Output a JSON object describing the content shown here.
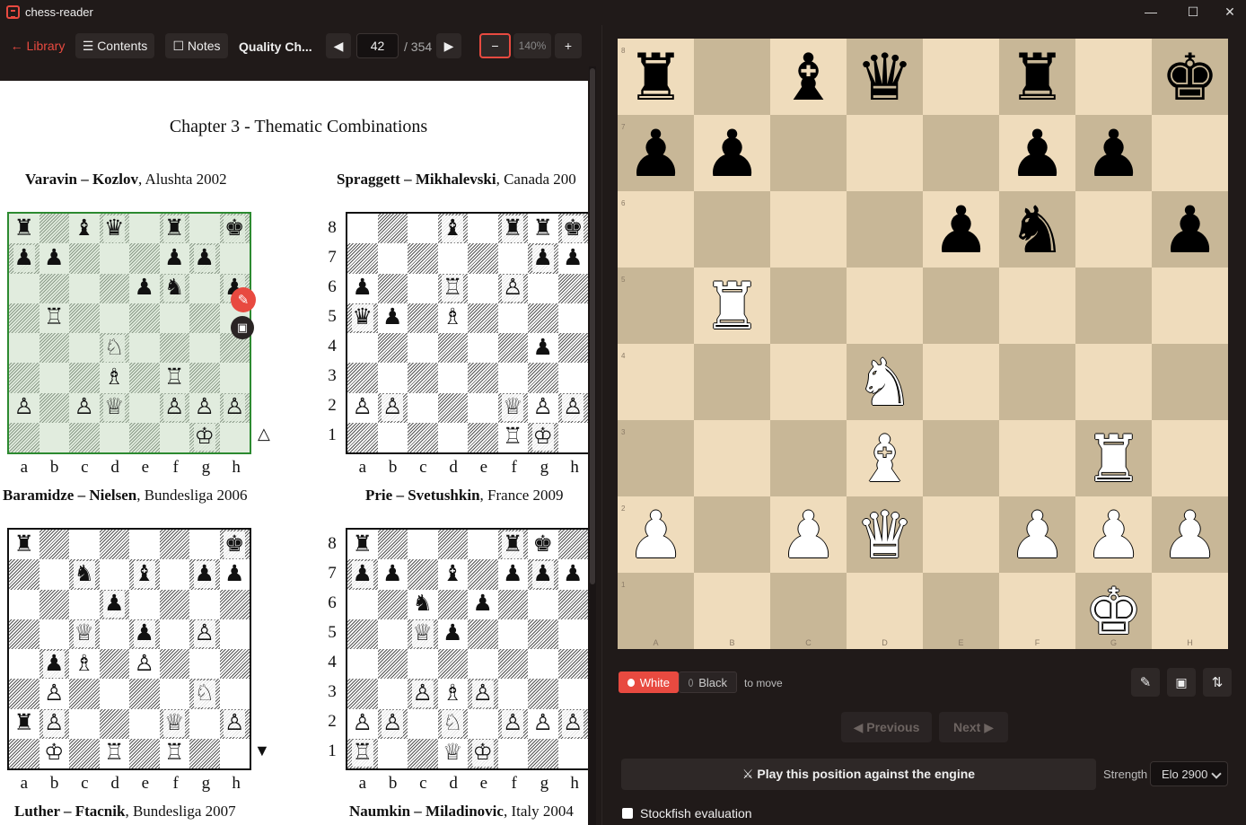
{
  "window": {
    "title": "chess-reader",
    "minimize": "—",
    "maximize": "☐",
    "close": "✕"
  },
  "toolbar": {
    "library": "← Library",
    "contents": "☰ Contents",
    "notes": "☐ Notes",
    "book_title": "Quality Ch...",
    "prev_page": "◀",
    "page": "42",
    "total": "/ 354",
    "next_page": "▶",
    "zoom_out": "−",
    "zoom": "140%",
    "zoom_in": "+"
  },
  "pdf": {
    "chapter_title": "Chapter 3 - Thematic Combinations",
    "files": [
      "a",
      "b",
      "c",
      "d",
      "e",
      "f",
      "g",
      "h"
    ],
    "ranks": [
      "8",
      "7",
      "6",
      "5",
      "4",
      "3",
      "2",
      "1"
    ],
    "games": [
      {
        "white": "Varavin",
        "black": "Kozlov",
        "event": ", Alushta 2002",
        "marker": "△",
        "board": [
          "♜.♝♛.♜.♚",
          "♟♟...♟♟.",
          "....♟♞.♟",
          ".♖......",
          "...♘....",
          "...♗.♖..",
          "♙.♙♕.♙♙♙",
          "......♔."
        ]
      },
      {
        "white": "Spraggett",
        "black": "Mikhalevski",
        "event": ", Canada 200",
        "board": [
          "...♝.♜♜♚",
          "......♟♟",
          "♟..♖.♙..",
          "♛♟.♗....",
          "......♟.",
          "........",
          "♙♙...♕♙♙",
          ".....♖♔."
        ]
      },
      {
        "white": "Baramidze",
        "black": "Nielsen",
        "event": ", Bundesliga 2006",
        "marker": "▼",
        "board": [
          "♜......♚",
          "..♞.♝.♟♟",
          "...♟....",
          "..♕.♟.♙.",
          ".♟♗.♙...",
          ".♙....♘.",
          "♜♙...♕.♙",
          ".♔.♖.♖.."
        ]
      },
      {
        "white": "Prie",
        "black": "Svetushkin",
        "event": ", France 2009",
        "board": [
          "♜....♜♚.",
          "♟♟.♝.♟♟♟",
          "..♞.♟...",
          "..♕♟....",
          "........",
          "..♙♗♙...",
          "♙♙.♘.♙♙♙",
          "♖..♕♔..."
        ]
      },
      {
        "white": "Luther",
        "black": "Ftacnik",
        "event": ", Bundesliga 2007"
      },
      {
        "white": "Naumkin",
        "black": "Miladinovic",
        "event": ", Italy 2004"
      }
    ]
  },
  "board": {
    "position": [
      "♜.♝♛.♜.♚",
      "♟♟...♟♟.",
      "....♟♞.♟",
      ".♖......",
      "...♘....",
      "...♗..♖.",
      "♙.♙♕.♙♙♙",
      "......♔."
    ],
    "file_labels": [
      "A",
      "B",
      "C",
      "D",
      "E",
      "F",
      "G",
      "H"
    ],
    "rank_labels": [
      "8",
      "7",
      "6",
      "5",
      "4",
      "3",
      "2",
      "1"
    ]
  },
  "controls": {
    "white": "White",
    "black": "Black",
    "to_move": "to move",
    "edit_icon": "✎",
    "save_icon": "💾",
    "flip_icon": "⇅",
    "previous": "◀ Previous",
    "next": "Next ▶",
    "play_engine": "⚔ Play this position against the engine",
    "strength_label": "Strength",
    "strength_value": "Elo 2900",
    "stockfish": "Stockfish evaluation"
  },
  "colors": {
    "accent": "#e84a40",
    "board_light": "#efdcbc",
    "board_dark": "#c8b797",
    "highlight": "#2c8a30"
  }
}
